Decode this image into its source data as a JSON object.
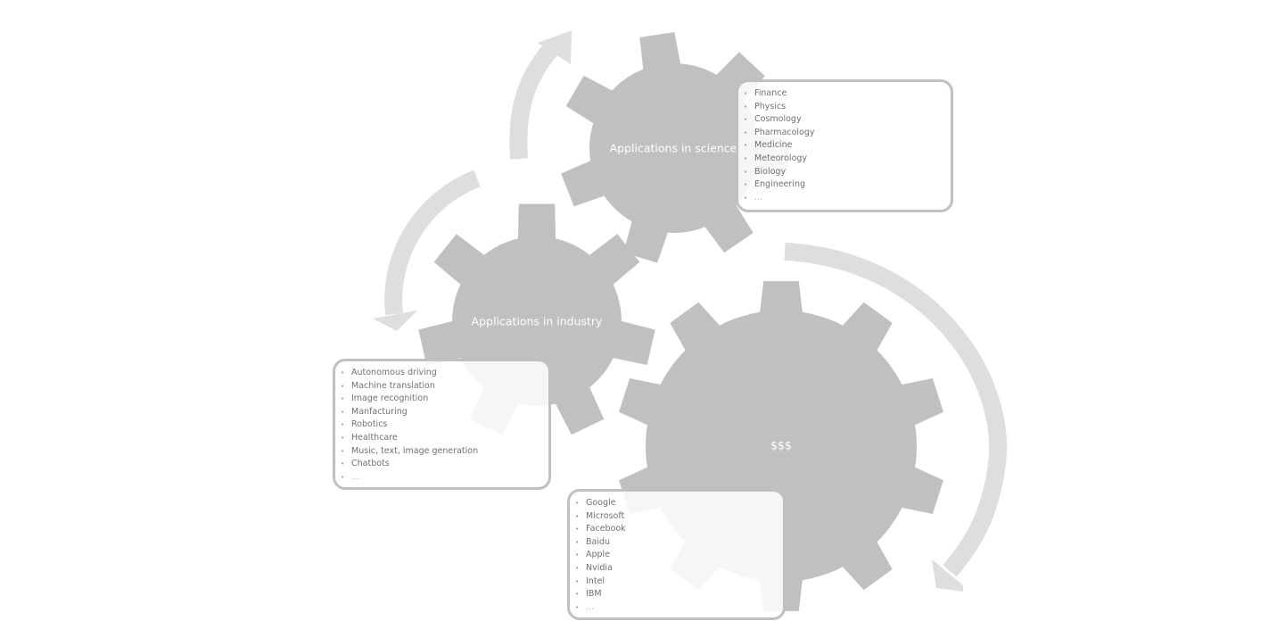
{
  "colors": {
    "gear": "#c0c0c0",
    "arrow": "#dedede",
    "box_border": "#c0c0c0",
    "text": "#707070"
  },
  "gears": {
    "science": {
      "label": "Applications in science",
      "items": [
        "Finance",
        "Physics",
        "Cosmology",
        "Pharmacology",
        "Medicine",
        "Meteorology",
        "Biology",
        "Engineering",
        "..."
      ]
    },
    "industry": {
      "label": "Applications in industry",
      "items": [
        "Autonomous driving",
        "Machine translation",
        "Image recognition",
        "Manfacturing",
        "Robotics",
        "Healthcare",
        "Music, text, image generation",
        "Chatbots",
        "..."
      ]
    },
    "money": {
      "label": "$$$",
      "items": [
        "Google",
        "Microsoft",
        "Facebook",
        "Baidu",
        "Apple",
        "Nvidia",
        "Intel",
        "IBM",
        "..."
      ]
    }
  }
}
